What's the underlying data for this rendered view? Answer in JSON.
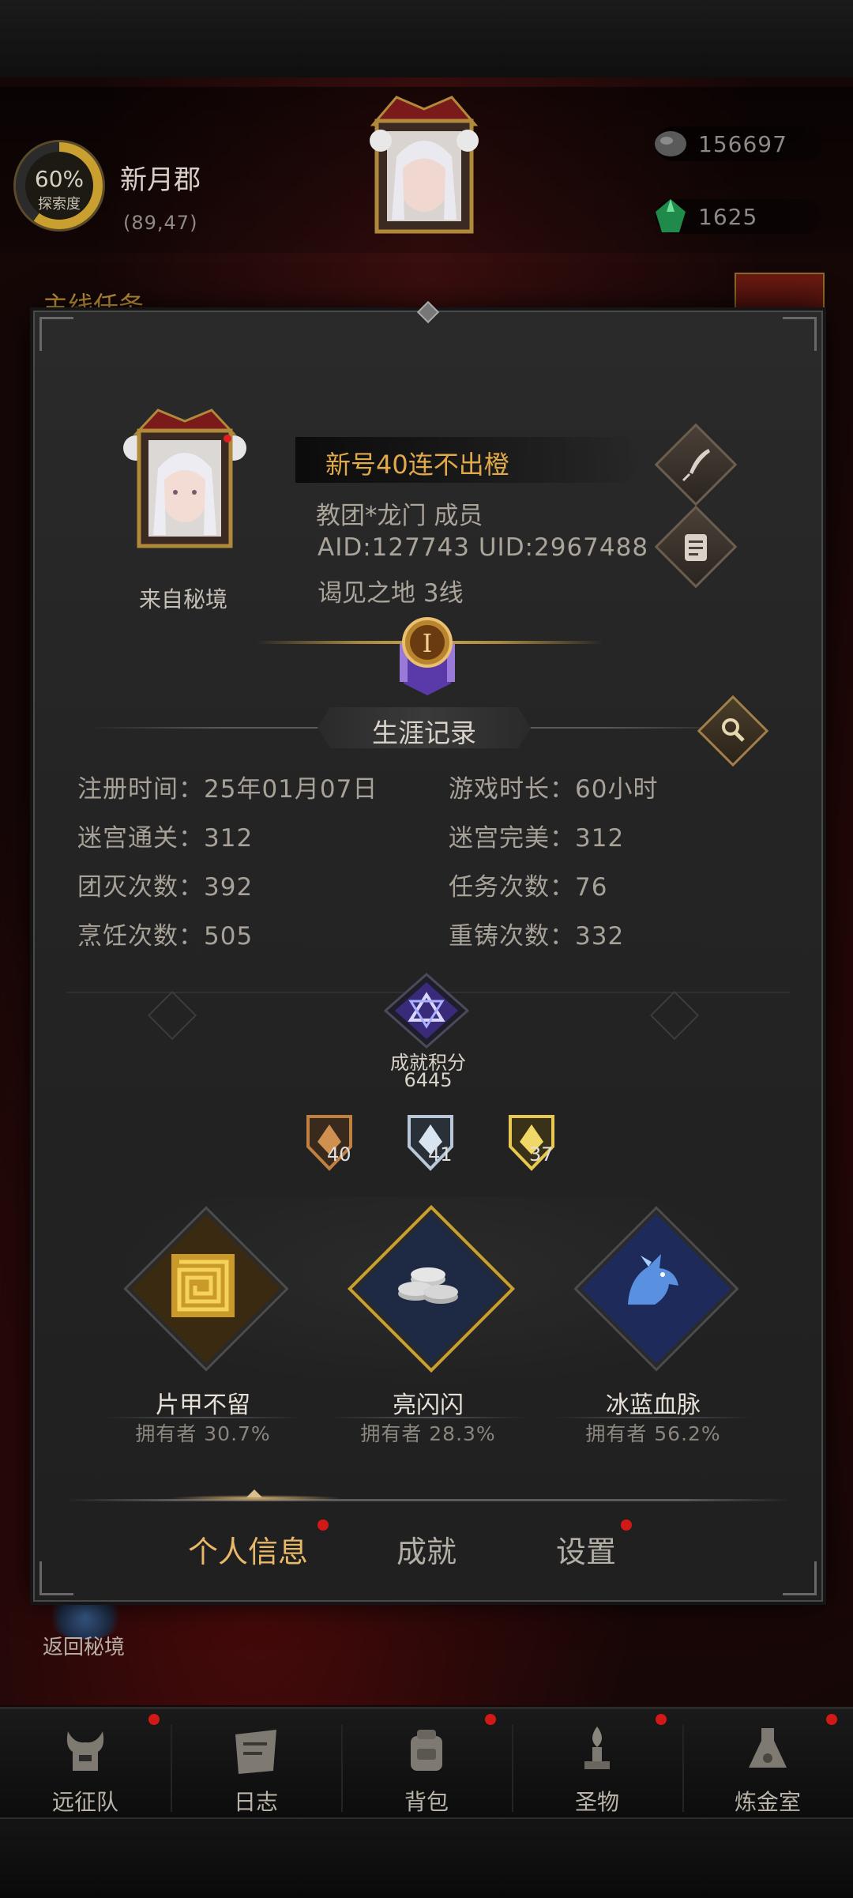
{
  "top_bar": {
    "explore_percent": "60%",
    "explore_label": "探索度",
    "region_name": "新月郡",
    "region_coords": "(89,47)",
    "currency_1": "156697",
    "currency_2": "1625",
    "main_quest_label": "主线任务"
  },
  "side": {
    "return_label": "返回秘境"
  },
  "profile": {
    "player_name": "新号40连不出橙",
    "guild": "教团*龙门  成员",
    "ids": "AID:127743 UID:2967488",
    "server": "谒见之地  3线",
    "from_label": "来自秘境",
    "rank_numeral": "I"
  },
  "career": {
    "title": "生涯记录",
    "stats": [
      {
        "label": "注册时间：",
        "value": "25年01月07日"
      },
      {
        "label": "游戏时长：",
        "value": "60小时"
      },
      {
        "label": "迷宫通关：",
        "value": "312"
      },
      {
        "label": "迷宫完美：",
        "value": "312"
      },
      {
        "label": "团灭次数：",
        "value": "392"
      },
      {
        "label": "任务次数：",
        "value": "76"
      },
      {
        "label": "烹饪次数：",
        "value": "505"
      },
      {
        "label": "重铸次数：",
        "value": "332"
      }
    ]
  },
  "achievement": {
    "points_label": "成就积分",
    "points_value": "6445",
    "medals": [
      {
        "tier": "bronze",
        "count": "40"
      },
      {
        "tier": "silver",
        "count": "41"
      },
      {
        "tier": "gold",
        "count": "37"
      }
    ],
    "featured": [
      {
        "name": "片甲不留",
        "owners": "拥有者 30.7%",
        "icon": "maze-icon"
      },
      {
        "name": "亮闪闪",
        "owners": "拥有者 28.3%",
        "icon": "coins-icon"
      },
      {
        "name": "冰蓝血脉",
        "owners": "拥有者 56.2%",
        "icon": "ice-dragon-icon"
      }
    ]
  },
  "tabs": [
    {
      "label": "个人信息",
      "active": true,
      "has_dot": true
    },
    {
      "label": "成就",
      "active": false,
      "has_dot": false
    },
    {
      "label": "设置",
      "active": false,
      "has_dot": true
    }
  ],
  "bottom_nav": [
    {
      "label": "远征队",
      "icon": "helmet-icon"
    },
    {
      "label": "日志",
      "icon": "journal-icon"
    },
    {
      "label": "背包",
      "icon": "backpack-icon"
    },
    {
      "label": "圣物",
      "icon": "relic-icon"
    },
    {
      "label": "炼金室",
      "icon": "alchemy-icon"
    }
  ],
  "colors": {
    "accent_gold": "#e0a94a",
    "notification_red": "#d31818",
    "dialog_bg": "#242424"
  }
}
